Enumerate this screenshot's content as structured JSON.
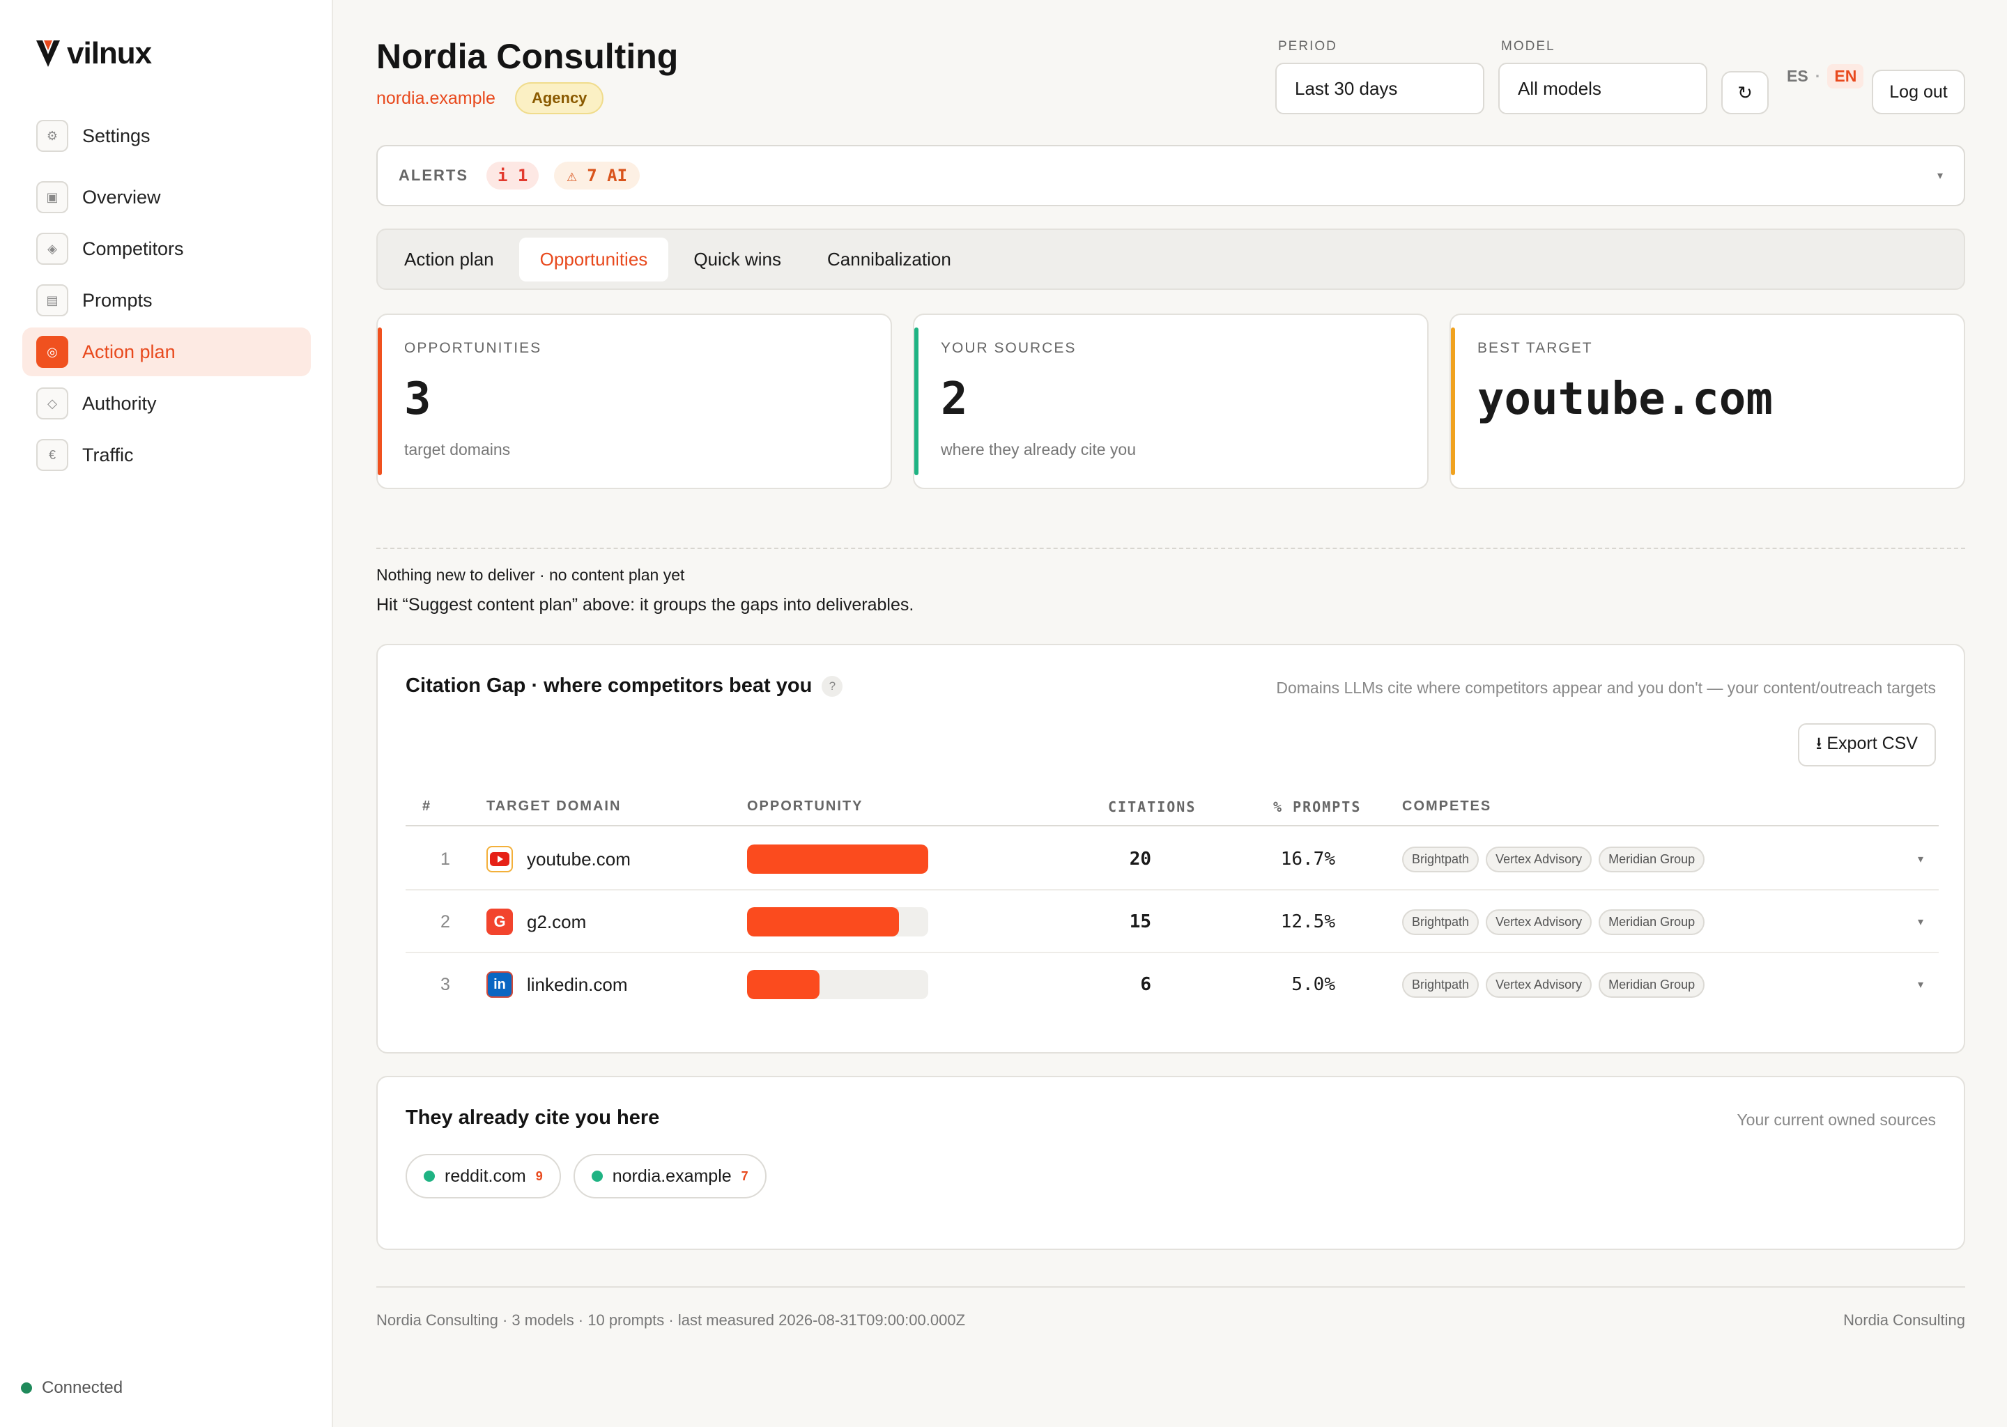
{
  "brand": {
    "name": "vilnux",
    "accent": "#e8491d"
  },
  "sidebar": {
    "items": [
      {
        "label": "Settings",
        "icon": "gear-icon"
      },
      {
        "label": "Overview",
        "icon": "square-icon"
      },
      {
        "label": "Competitors",
        "icon": "diamond-icon"
      },
      {
        "label": "Prompts",
        "icon": "list-icon"
      },
      {
        "label": "Action plan",
        "icon": "target-icon",
        "active": true
      },
      {
        "label": "Authority",
        "icon": "diamond-outline-icon"
      },
      {
        "label": "Traffic",
        "icon": "euro-icon"
      }
    ],
    "status": "Connected"
  },
  "header": {
    "title": "Nordia Consulting",
    "domain": "nordia.example",
    "badge": "Agency",
    "period_label": "PERIOD",
    "period_value": "Last 30 days",
    "model_label": "MODEL",
    "model_value": "All models",
    "refresh_glyph": "↻",
    "lang_es": "ES",
    "lang_sep": "·",
    "lang_en": "EN",
    "logout": "Log out"
  },
  "alerts": {
    "label": "ALERTS",
    "info": "i 1",
    "warn": "⚠ 7 AI",
    "caret": "▾"
  },
  "tabs": [
    "Action plan",
    "Opportunities",
    "Quick wins",
    "Cannibalization"
  ],
  "kpis": [
    {
      "label": "OPPORTUNITIES",
      "value": "3",
      "note": "target domains",
      "color": "#f0511f"
    },
    {
      "label": "YOUR SOURCES",
      "value": "2",
      "note": "where they already cite you",
      "color": "#1fb383"
    },
    {
      "label": "BEST TARGET",
      "value": "youtube.com",
      "note": "",
      "color": "#f0a21f"
    }
  ],
  "empty": {
    "line1": "Nothing new to deliver · no content plan yet",
    "line2": "Hit “Suggest content plan” above: it groups the gaps into deliverables."
  },
  "citation_gap": {
    "title": "Citation Gap · where competitors beat you",
    "help": "?",
    "hint": "Domains LLMs cite where competitors appear and you don't — your content/outreach targets",
    "export": "⭳ Export CSV",
    "columns": [
      "#",
      "TARGET DOMAIN",
      "OPPORTUNITY",
      "CITATIONS",
      "% PROMPTS",
      "COMPETES"
    ],
    "rows": [
      {
        "rank": "1",
        "domain": "youtube.com",
        "icon": "youtube-icon",
        "opportunity": 1.0,
        "citations": "20",
        "prompts": "16.7%",
        "competes": [
          "Brightpath",
          "Vertex Advisory",
          "Meridian Group"
        ]
      },
      {
        "rank": "2",
        "domain": "g2.com",
        "icon": "g2-icon",
        "opportunity": 0.84,
        "citations": "15",
        "prompts": "12.5%",
        "competes": [
          "Brightpath",
          "Vertex Advisory",
          "Meridian Group"
        ]
      },
      {
        "rank": "3",
        "domain": "linkedin.com",
        "icon": "linkedin-icon",
        "opportunity": 0.4,
        "citations": "6",
        "prompts": "5.0%",
        "competes": [
          "Brightpath",
          "Vertex Advisory",
          "Meridian Group"
        ]
      }
    ]
  },
  "owned": {
    "title": "They already cite you here",
    "hint": "Your current owned sources",
    "items": [
      {
        "domain": "reddit.com",
        "count": "9"
      },
      {
        "domain": "nordia.example",
        "count": "7"
      }
    ]
  },
  "footer": {
    "left": "Nordia Consulting · 3 models · 10 prompts · last measured 2026-08-31T09:00:00.000Z",
    "right": "Nordia Consulting"
  }
}
